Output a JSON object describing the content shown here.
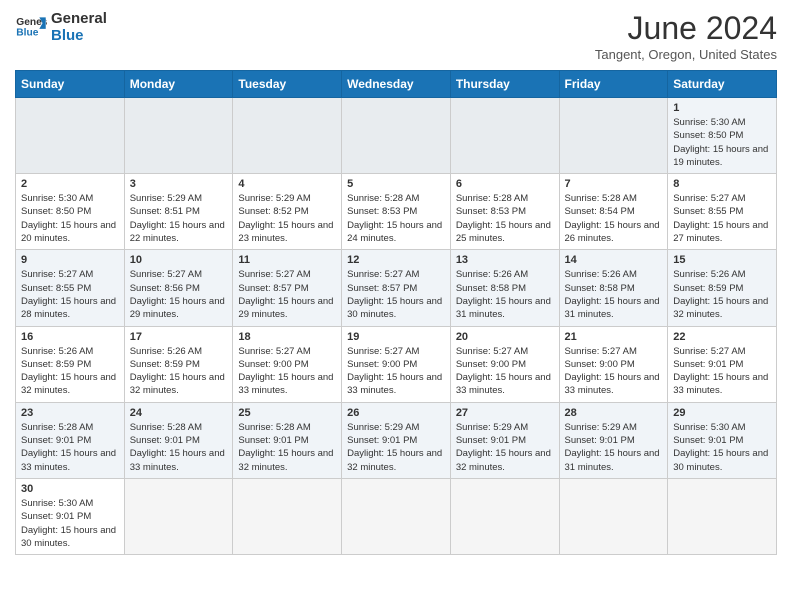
{
  "header": {
    "logo_line1": "General",
    "logo_line2": "Blue",
    "month_title": "June 2024",
    "subtitle": "Tangent, Oregon, United States"
  },
  "weekdays": [
    "Sunday",
    "Monday",
    "Tuesday",
    "Wednesday",
    "Thursday",
    "Friday",
    "Saturday"
  ],
  "weeks": [
    [
      {
        "day": "",
        "empty": true
      },
      {
        "day": "",
        "empty": true
      },
      {
        "day": "",
        "empty": true
      },
      {
        "day": "",
        "empty": true
      },
      {
        "day": "",
        "empty": true
      },
      {
        "day": "",
        "empty": true
      },
      {
        "day": "1",
        "sunrise": "5:30 AM",
        "sunset": "8:50 PM",
        "daylight": "15 hours and 19 minutes."
      }
    ],
    [
      {
        "day": "2",
        "sunrise": "5:30 AM",
        "sunset": "8:50 PM",
        "daylight": "15 hours and 20 minutes."
      },
      {
        "day": "3",
        "sunrise": "5:29 AM",
        "sunset": "8:51 PM",
        "daylight": "15 hours and 22 minutes."
      },
      {
        "day": "4",
        "sunrise": "5:29 AM",
        "sunset": "8:52 PM",
        "daylight": "15 hours and 23 minutes."
      },
      {
        "day": "5",
        "sunrise": "5:28 AM",
        "sunset": "8:53 PM",
        "daylight": "15 hours and 24 minutes."
      },
      {
        "day": "6",
        "sunrise": "5:28 AM",
        "sunset": "8:53 PM",
        "daylight": "15 hours and 25 minutes."
      },
      {
        "day": "7",
        "sunrise": "5:28 AM",
        "sunset": "8:54 PM",
        "daylight": "15 hours and 26 minutes."
      },
      {
        "day": "8",
        "sunrise": "5:27 AM",
        "sunset": "8:55 PM",
        "daylight": "15 hours and 27 minutes."
      }
    ],
    [
      {
        "day": "9",
        "sunrise": "5:27 AM",
        "sunset": "8:55 PM",
        "daylight": "15 hours and 28 minutes."
      },
      {
        "day": "10",
        "sunrise": "5:27 AM",
        "sunset": "8:56 PM",
        "daylight": "15 hours and 29 minutes."
      },
      {
        "day": "11",
        "sunrise": "5:27 AM",
        "sunset": "8:57 PM",
        "daylight": "15 hours and 29 minutes."
      },
      {
        "day": "12",
        "sunrise": "5:27 AM",
        "sunset": "8:57 PM",
        "daylight": "15 hours and 30 minutes."
      },
      {
        "day": "13",
        "sunrise": "5:26 AM",
        "sunset": "8:58 PM",
        "daylight": "15 hours and 31 minutes."
      },
      {
        "day": "14",
        "sunrise": "5:26 AM",
        "sunset": "8:58 PM",
        "daylight": "15 hours and 31 minutes."
      },
      {
        "day": "15",
        "sunrise": "5:26 AM",
        "sunset": "8:59 PM",
        "daylight": "15 hours and 32 minutes."
      }
    ],
    [
      {
        "day": "16",
        "sunrise": "5:26 AM",
        "sunset": "8:59 PM",
        "daylight": "15 hours and 32 minutes."
      },
      {
        "day": "17",
        "sunrise": "5:26 AM",
        "sunset": "8:59 PM",
        "daylight": "15 hours and 32 minutes."
      },
      {
        "day": "18",
        "sunrise": "5:27 AM",
        "sunset": "9:00 PM",
        "daylight": "15 hours and 33 minutes."
      },
      {
        "day": "19",
        "sunrise": "5:27 AM",
        "sunset": "9:00 PM",
        "daylight": "15 hours and 33 minutes."
      },
      {
        "day": "20",
        "sunrise": "5:27 AM",
        "sunset": "9:00 PM",
        "daylight": "15 hours and 33 minutes."
      },
      {
        "day": "21",
        "sunrise": "5:27 AM",
        "sunset": "9:00 PM",
        "daylight": "15 hours and 33 minutes."
      },
      {
        "day": "22",
        "sunrise": "5:27 AM",
        "sunset": "9:01 PM",
        "daylight": "15 hours and 33 minutes."
      }
    ],
    [
      {
        "day": "23",
        "sunrise": "5:28 AM",
        "sunset": "9:01 PM",
        "daylight": "15 hours and 33 minutes."
      },
      {
        "day": "24",
        "sunrise": "5:28 AM",
        "sunset": "9:01 PM",
        "daylight": "15 hours and 33 minutes."
      },
      {
        "day": "25",
        "sunrise": "5:28 AM",
        "sunset": "9:01 PM",
        "daylight": "15 hours and 32 minutes."
      },
      {
        "day": "26",
        "sunrise": "5:29 AM",
        "sunset": "9:01 PM",
        "daylight": "15 hours and 32 minutes."
      },
      {
        "day": "27",
        "sunrise": "5:29 AM",
        "sunset": "9:01 PM",
        "daylight": "15 hours and 32 minutes."
      },
      {
        "day": "28",
        "sunrise": "5:29 AM",
        "sunset": "9:01 PM",
        "daylight": "15 hours and 31 minutes."
      },
      {
        "day": "29",
        "sunrise": "5:30 AM",
        "sunset": "9:01 PM",
        "daylight": "15 hours and 30 minutes."
      }
    ],
    [
      {
        "day": "30",
        "sunrise": "5:30 AM",
        "sunset": "9:01 PM",
        "daylight": "15 hours and 30 minutes."
      },
      {
        "day": "",
        "empty": true
      },
      {
        "day": "",
        "empty": true
      },
      {
        "day": "",
        "empty": true
      },
      {
        "day": "",
        "empty": true
      },
      {
        "day": "",
        "empty": true
      },
      {
        "day": "",
        "empty": true
      }
    ]
  ]
}
